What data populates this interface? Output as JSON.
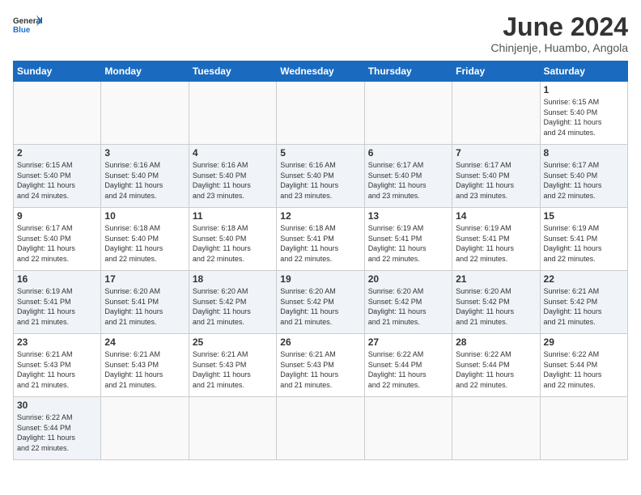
{
  "header": {
    "logo_general": "General",
    "logo_blue": "Blue",
    "month_title": "June 2024",
    "location": "Chinjenje, Huambo, Angola"
  },
  "weekdays": [
    "Sunday",
    "Monday",
    "Tuesday",
    "Wednesday",
    "Thursday",
    "Friday",
    "Saturday"
  ],
  "weeks": [
    [
      {
        "day": "",
        "info": ""
      },
      {
        "day": "",
        "info": ""
      },
      {
        "day": "",
        "info": ""
      },
      {
        "day": "",
        "info": ""
      },
      {
        "day": "",
        "info": ""
      },
      {
        "day": "",
        "info": ""
      },
      {
        "day": "1",
        "info": "Sunrise: 6:15 AM\nSunset: 5:40 PM\nDaylight: 11 hours\nand 24 minutes."
      }
    ],
    [
      {
        "day": "2",
        "info": "Sunrise: 6:15 AM\nSunset: 5:40 PM\nDaylight: 11 hours\nand 24 minutes."
      },
      {
        "day": "3",
        "info": "Sunrise: 6:16 AM\nSunset: 5:40 PM\nDaylight: 11 hours\nand 24 minutes."
      },
      {
        "day": "4",
        "info": "Sunrise: 6:16 AM\nSunset: 5:40 PM\nDaylight: 11 hours\nand 23 minutes."
      },
      {
        "day": "5",
        "info": "Sunrise: 6:16 AM\nSunset: 5:40 PM\nDaylight: 11 hours\nand 23 minutes."
      },
      {
        "day": "6",
        "info": "Sunrise: 6:17 AM\nSunset: 5:40 PM\nDaylight: 11 hours\nand 23 minutes."
      },
      {
        "day": "7",
        "info": "Sunrise: 6:17 AM\nSunset: 5:40 PM\nDaylight: 11 hours\nand 23 minutes."
      },
      {
        "day": "8",
        "info": "Sunrise: 6:17 AM\nSunset: 5:40 PM\nDaylight: 11 hours\nand 22 minutes."
      }
    ],
    [
      {
        "day": "9",
        "info": "Sunrise: 6:17 AM\nSunset: 5:40 PM\nDaylight: 11 hours\nand 22 minutes."
      },
      {
        "day": "10",
        "info": "Sunrise: 6:18 AM\nSunset: 5:40 PM\nDaylight: 11 hours\nand 22 minutes."
      },
      {
        "day": "11",
        "info": "Sunrise: 6:18 AM\nSunset: 5:40 PM\nDaylight: 11 hours\nand 22 minutes."
      },
      {
        "day": "12",
        "info": "Sunrise: 6:18 AM\nSunset: 5:41 PM\nDaylight: 11 hours\nand 22 minutes."
      },
      {
        "day": "13",
        "info": "Sunrise: 6:19 AM\nSunset: 5:41 PM\nDaylight: 11 hours\nand 22 minutes."
      },
      {
        "day": "14",
        "info": "Sunrise: 6:19 AM\nSunset: 5:41 PM\nDaylight: 11 hours\nand 22 minutes."
      },
      {
        "day": "15",
        "info": "Sunrise: 6:19 AM\nSunset: 5:41 PM\nDaylight: 11 hours\nand 22 minutes."
      }
    ],
    [
      {
        "day": "16",
        "info": "Sunrise: 6:19 AM\nSunset: 5:41 PM\nDaylight: 11 hours\nand 21 minutes."
      },
      {
        "day": "17",
        "info": "Sunrise: 6:20 AM\nSunset: 5:41 PM\nDaylight: 11 hours\nand 21 minutes."
      },
      {
        "day": "18",
        "info": "Sunrise: 6:20 AM\nSunset: 5:42 PM\nDaylight: 11 hours\nand 21 minutes."
      },
      {
        "day": "19",
        "info": "Sunrise: 6:20 AM\nSunset: 5:42 PM\nDaylight: 11 hours\nand 21 minutes."
      },
      {
        "day": "20",
        "info": "Sunrise: 6:20 AM\nSunset: 5:42 PM\nDaylight: 11 hours\nand 21 minutes."
      },
      {
        "day": "21",
        "info": "Sunrise: 6:20 AM\nSunset: 5:42 PM\nDaylight: 11 hours\nand 21 minutes."
      },
      {
        "day": "22",
        "info": "Sunrise: 6:21 AM\nSunset: 5:42 PM\nDaylight: 11 hours\nand 21 minutes."
      }
    ],
    [
      {
        "day": "23",
        "info": "Sunrise: 6:21 AM\nSunset: 5:43 PM\nDaylight: 11 hours\nand 21 minutes."
      },
      {
        "day": "24",
        "info": "Sunrise: 6:21 AM\nSunset: 5:43 PM\nDaylight: 11 hours\nand 21 minutes."
      },
      {
        "day": "25",
        "info": "Sunrise: 6:21 AM\nSunset: 5:43 PM\nDaylight: 11 hours\nand 21 minutes."
      },
      {
        "day": "26",
        "info": "Sunrise: 6:21 AM\nSunset: 5:43 PM\nDaylight: 11 hours\nand 21 minutes."
      },
      {
        "day": "27",
        "info": "Sunrise: 6:22 AM\nSunset: 5:44 PM\nDaylight: 11 hours\nand 22 minutes."
      },
      {
        "day": "28",
        "info": "Sunrise: 6:22 AM\nSunset: 5:44 PM\nDaylight: 11 hours\nand 22 minutes."
      },
      {
        "day": "29",
        "info": "Sunrise: 6:22 AM\nSunset: 5:44 PM\nDaylight: 11 hours\nand 22 minutes."
      }
    ],
    [
      {
        "day": "30",
        "info": "Sunrise: 6:22 AM\nSunset: 5:44 PM\nDaylight: 11 hours\nand 22 minutes."
      },
      {
        "day": "",
        "info": ""
      },
      {
        "day": "",
        "info": ""
      },
      {
        "day": "",
        "info": ""
      },
      {
        "day": "",
        "info": ""
      },
      {
        "day": "",
        "info": ""
      },
      {
        "day": "",
        "info": ""
      }
    ]
  ]
}
